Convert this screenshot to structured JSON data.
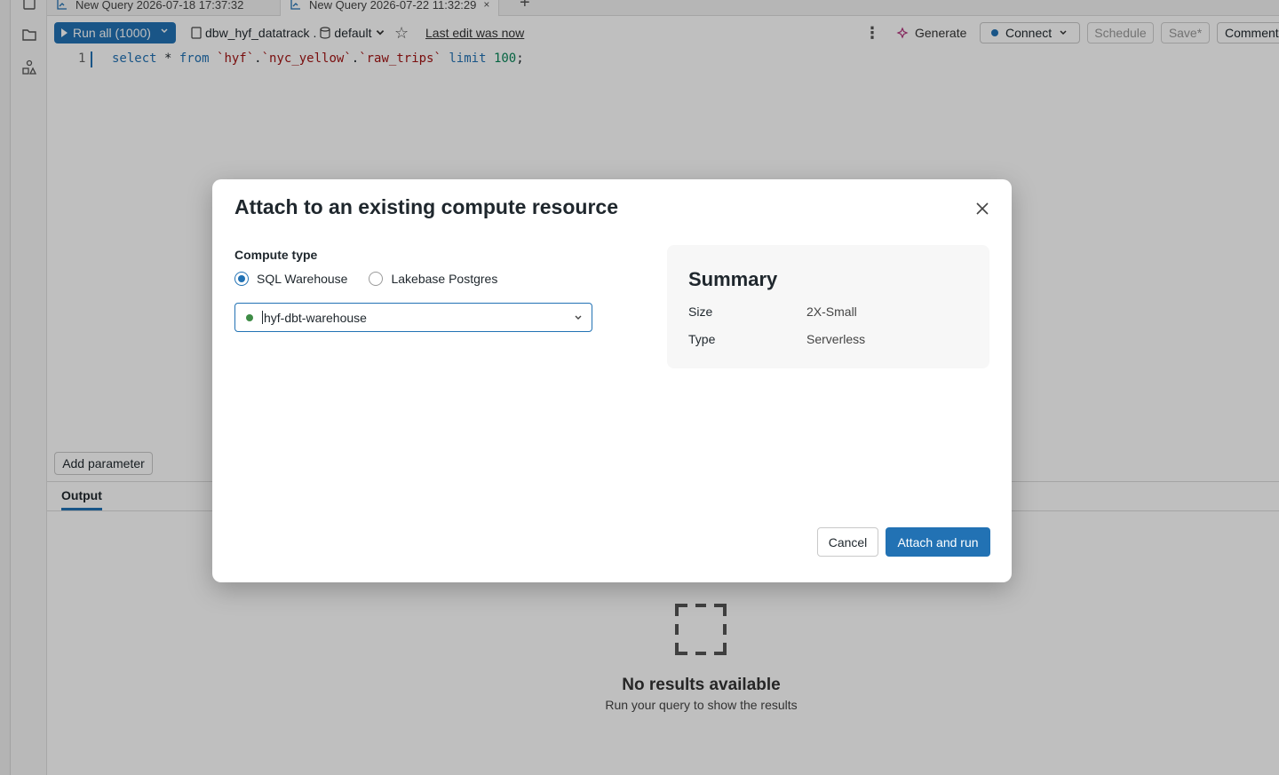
{
  "tabs": [
    {
      "label": "New Query 2026-07-18 17:37:32",
      "icon": "query-icon"
    },
    {
      "label": "New Query 2026-07-22 11:32:29",
      "icon": "query-icon",
      "close": "×"
    }
  ],
  "toolbar": {
    "run_label": "Run all",
    "run_limit": "(1000)",
    "catalog": "dbw_hyf_datatrack",
    "catalog_sep": ".",
    "schema": "default",
    "last_edit": "Last edit was now",
    "generate_label": "Generate",
    "connect_label": "Connect",
    "schedule_label": "Schedule",
    "save_label": "Save*",
    "comment_label": "Comment"
  },
  "editor": {
    "line_number": "1",
    "code": {
      "kw1": "select",
      "star": " * ",
      "kw2": "from",
      "s1": " `hyf`",
      "dot1": ".",
      "s2": "`nyc_yellow`",
      "dot2": ".",
      "s3": "`raw_trips`",
      "kw3": " limit ",
      "n1": "100",
      "end": ";"
    }
  },
  "add_parameter_label": "Add parameter",
  "output_tab_label": "Output",
  "empty_state": {
    "title": "No results available",
    "subtitle": "Run your query to show the results"
  },
  "modal": {
    "title": "Attach to an existing compute resource",
    "compute_type_label": "Compute type",
    "options": [
      {
        "label": "SQL Warehouse",
        "selected": true
      },
      {
        "label": "Lakebase Postgres",
        "selected": false
      }
    ],
    "selected_warehouse": "hyf-dbt-warehouse",
    "summary": {
      "title": "Summary",
      "rows": [
        {
          "key": "Size",
          "value": "2X-Small"
        },
        {
          "key": "Type",
          "value": "Serverless"
        }
      ]
    },
    "cancel_label": "Cancel",
    "attach_label": "Attach and run"
  },
  "colors": {
    "primary": "#2272b4",
    "status_running": "#3e8c46"
  }
}
